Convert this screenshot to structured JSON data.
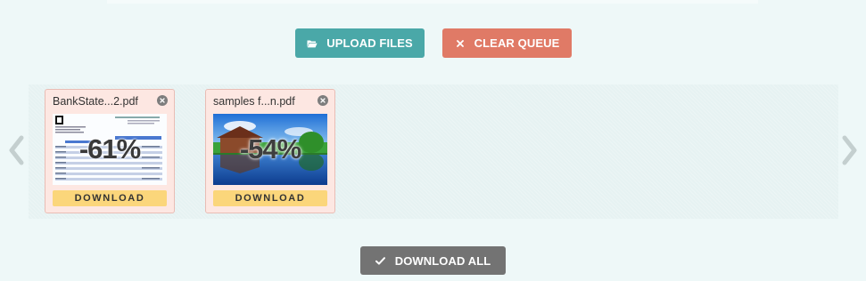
{
  "toolbar": {
    "upload_label": "UPLOAD FILES",
    "clear_label": "CLEAR QUEUE",
    "upload_icon": "folder-open-icon",
    "clear_icon": "close-x-icon"
  },
  "queue": {
    "files": [
      {
        "name": "BankState...2.pdf",
        "savings": "-61%",
        "download_label": "DOWNLOAD",
        "thumbnail": "document-preview"
      },
      {
        "name": "samples f...n.pdf",
        "savings": "-54%",
        "download_label": "DOWNLOAD",
        "thumbnail": "landscape-photo-preview"
      }
    ]
  },
  "download_all": {
    "label": "DOWNLOAD ALL",
    "icon": "checkmark-icon"
  },
  "colors": {
    "background": "#eef8f8",
    "upload_button": "#4aa8a8",
    "clear_button": "#e07a66",
    "download_all_button": "#737373",
    "card_background": "#fde7e2",
    "download_button": "#fbd67b"
  }
}
